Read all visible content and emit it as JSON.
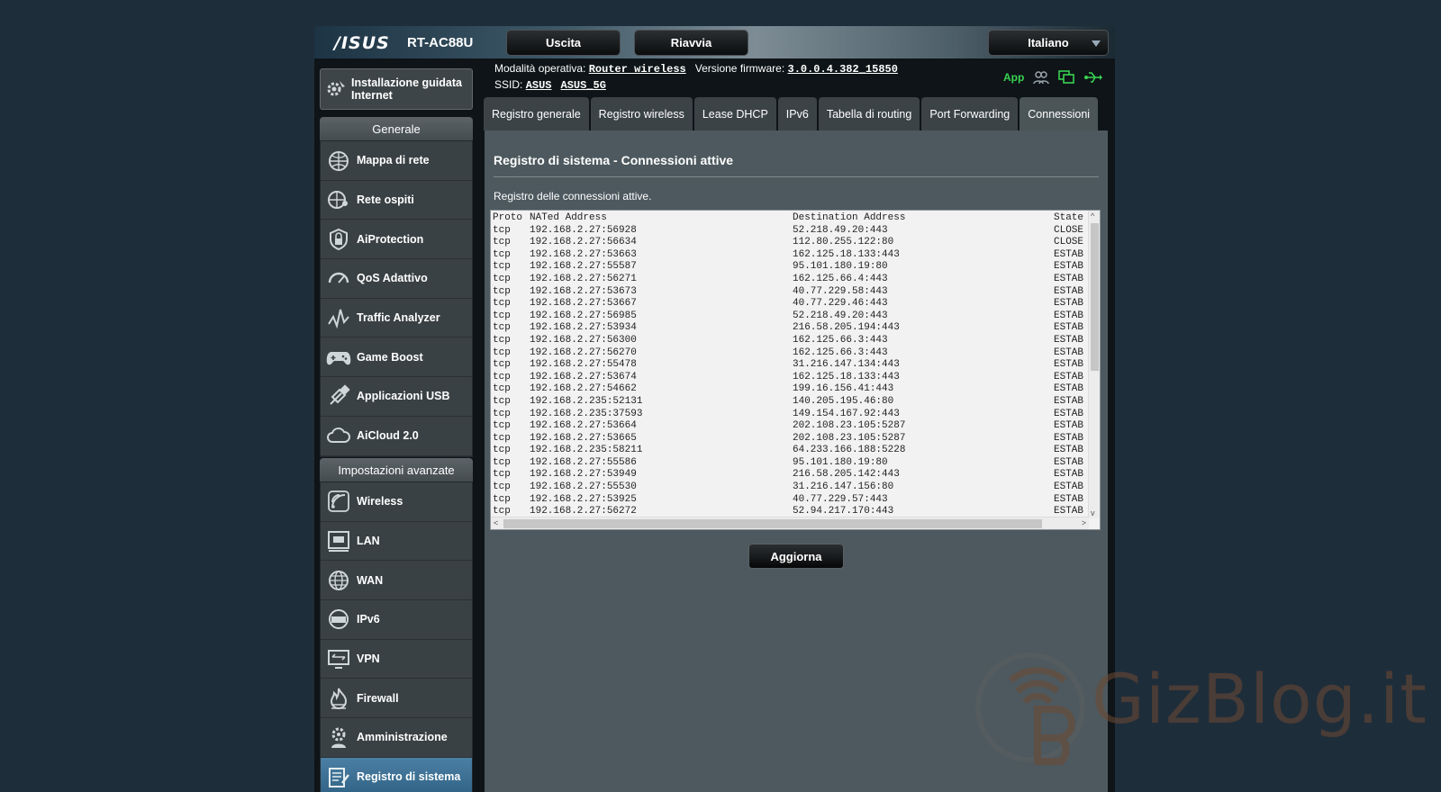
{
  "header": {
    "brand": "/ISUS",
    "model": "RT-AC88U",
    "logout_label": "Uscita",
    "reboot_label": "Riavvia",
    "language": "Italiano"
  },
  "info": {
    "op_mode_label": "Modalità operativa:",
    "op_mode_value": "Router wireless",
    "firmware_label": "Versione firmware:",
    "firmware_value": "3.0.0.4.382_15850",
    "ssid_label": "SSID:",
    "ssid_1": "ASUS",
    "ssid_2": "ASUS_5G",
    "app_label": "App"
  },
  "sidebar": {
    "wizard_label": "Installazione guidata Internet",
    "general_title": "Generale",
    "general_items": [
      {
        "label": "Mappa di rete",
        "icon": "network-map-icon"
      },
      {
        "label": "Rete ospiti",
        "icon": "guest-network-icon"
      },
      {
        "label": "AiProtection",
        "icon": "lock-shield-icon"
      },
      {
        "label": "QoS Adattivo",
        "icon": "gauge-icon"
      },
      {
        "label": "Traffic Analyzer",
        "icon": "pulse-icon"
      },
      {
        "label": "Game Boost",
        "icon": "gamepad-icon"
      },
      {
        "label": "Applicazioni USB",
        "icon": "usb-apps-icon"
      },
      {
        "label": "AiCloud 2.0",
        "icon": "cloud-icon"
      }
    ],
    "advanced_title": "Impostazioni avanzate",
    "advanced_items": [
      {
        "label": "Wireless",
        "icon": "wireless-icon"
      },
      {
        "label": "LAN",
        "icon": "lan-icon"
      },
      {
        "label": "WAN",
        "icon": "globe-icon"
      },
      {
        "label": "IPv6",
        "icon": "ipv6-icon"
      },
      {
        "label": "VPN",
        "icon": "vpn-icon"
      },
      {
        "label": "Firewall",
        "icon": "firewall-icon"
      },
      {
        "label": "Amministrazione",
        "icon": "gear-person-icon"
      },
      {
        "label": "Registro di sistema",
        "icon": "log-icon"
      }
    ]
  },
  "tabs": [
    {
      "label": "Registro generale"
    },
    {
      "label": "Registro wireless"
    },
    {
      "label": "Lease DHCP"
    },
    {
      "label": "IPv6"
    },
    {
      "label": "Tabella di routing"
    },
    {
      "label": "Port Forwarding"
    },
    {
      "label": "Connessioni",
      "active": true
    }
  ],
  "content": {
    "title": "Registro di sistema - Connessioni attive",
    "description": "Registro delle connessioni attive.",
    "refresh_label": "Aggiorna"
  },
  "log": {
    "headers": [
      "Proto",
      "NATed Address",
      "Destination Address",
      "State"
    ],
    "rows": [
      [
        "tcp",
        "192.168.2.27:56928",
        "52.218.49.20:443",
        "CLOSE"
      ],
      [
        "tcp",
        "192.168.2.27:56634",
        "112.80.255.122:80",
        "CLOSE"
      ],
      [
        "tcp",
        "192.168.2.27:53663",
        "162.125.18.133:443",
        "ESTAB"
      ],
      [
        "tcp",
        "192.168.2.27:55587",
        "95.101.180.19:80",
        "ESTAB"
      ],
      [
        "tcp",
        "192.168.2.27:56271",
        "162.125.66.4:443",
        "ESTAB"
      ],
      [
        "tcp",
        "192.168.2.27:53673",
        "40.77.229.58:443",
        "ESTAB"
      ],
      [
        "tcp",
        "192.168.2.27:53667",
        "40.77.229.46:443",
        "ESTAB"
      ],
      [
        "tcp",
        "192.168.2.27:56985",
        "52.218.49.20:443",
        "ESTAB"
      ],
      [
        "tcp",
        "192.168.2.27:53934",
        "216.58.205.194:443",
        "ESTAB"
      ],
      [
        "tcp",
        "192.168.2.27:56300",
        "162.125.66.3:443",
        "ESTAB"
      ],
      [
        "tcp",
        "192.168.2.27:56270",
        "162.125.66.3:443",
        "ESTAB"
      ],
      [
        "tcp",
        "192.168.2.27:55478",
        "31.216.147.134:443",
        "ESTAB"
      ],
      [
        "tcp",
        "192.168.2.27:53674",
        "162.125.18.133:443",
        "ESTAB"
      ],
      [
        "tcp",
        "192.168.2.27:54662",
        "199.16.156.41:443",
        "ESTAB"
      ],
      [
        "tcp",
        "192.168.2.235:52131",
        "140.205.195.46:80",
        "ESTAB"
      ],
      [
        "tcp",
        "192.168.2.235:37593",
        "149.154.167.92:443",
        "ESTAB"
      ],
      [
        "tcp",
        "192.168.2.27:53664",
        "202.108.23.105:5287",
        "ESTAB"
      ],
      [
        "tcp",
        "192.168.2.27:53665",
        "202.108.23.105:5287",
        "ESTAB"
      ],
      [
        "tcp",
        "192.168.2.235:58211",
        "64.233.166.188:5228",
        "ESTAB"
      ],
      [
        "tcp",
        "192.168.2.27:55586",
        "95.101.180.19:80",
        "ESTAB"
      ],
      [
        "tcp",
        "192.168.2.27:53949",
        "216.58.205.142:443",
        "ESTAB"
      ],
      [
        "tcp",
        "192.168.2.27:55530",
        "31.216.147.156:80",
        "ESTAB"
      ],
      [
        "tcp",
        "192.168.2.27:53925",
        "40.77.229.57:443",
        "ESTAB"
      ],
      [
        "tcp",
        "192.168.2.27:56272",
        "52.94.217.170:443",
        "ESTAB"
      ]
    ]
  },
  "watermark": {
    "text": "GizBlog.it"
  },
  "colors": {
    "accent_green": "#39d353",
    "active_menu": "#2f6285",
    "watermark": "#6e4a33"
  }
}
